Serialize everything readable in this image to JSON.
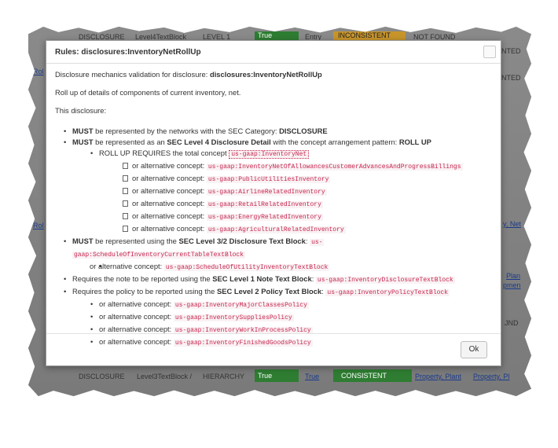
{
  "background_table": {
    "top_row": [
      "DISCLOSURE",
      "Level4TextBlock",
      "LEVEL 1",
      "True",
      "Entry",
      "INCONSISTENT",
      "NOT FOUND"
    ],
    "bottom_row": [
      "DISCLOSURE",
      "Level3TextBlock /",
      "HIERARCHY",
      "True",
      "True",
      "CONSISTENT",
      "Property, Plant",
      "Property, Pl"
    ],
    "side_fragments": [
      "NTED",
      "Rol",
      "NTED",
      "y, Net",
      "Plan",
      "pmen",
      "JND",
      "Rol"
    ]
  },
  "dialog": {
    "title": "Rules: disclosures:InventoryNetRollUp",
    "intro_prefix": "Disclosure mechanics validation for disclosure: ",
    "intro_name": "disclosures:InventoryNetRollUp",
    "description": "Roll up of details of components of current inventory, net.",
    "this_disclosure": "This disclosure:",
    "must": "MUST",
    "rule1_text": " be represented by the networks with the SEC Category: ",
    "rule1_value": "DISCLOSURE",
    "rule2_text": " be represented as an ",
    "rule2_bold": "SEC Level 4 Disclosure Detail",
    "rule2_text2": " with the concept arrangement pattern: ",
    "rule2_value": "ROLL UP",
    "rollup_text": "ROLL UP REQUIRES the total concept ",
    "rollup_concept": "us-gaap:InventoryNet",
    "alt_label": "or alternative concept: ",
    "rollup_alternatives": [
      "us-gaap:InventoryNetOfAllowancesCustomerAdvancesAndProgressBillings",
      "us-gaap:PublicUtilitiesInventory",
      "us-gaap:AirlineRelatedInventory",
      "us-gaap:RetailRelatedInventory",
      "us-gaap:EnergyRelatedInventory",
      "us-gaap:AgriculturalRelatedInventory"
    ],
    "rule3_text": " be represented using the ",
    "rule3_bold": "SEC Level 3/2 Disclosure Text Block",
    "rule3_concept_a": "us-",
    "rule3_concept_b": "gaap:ScheduleOfInventoryCurrentTableTextBlock",
    "rule3_alternative": "us-gaap:ScheduleOfUtilityInventoryTextBlock",
    "rule4_text": "Requires the note to be reported using the ",
    "rule4_bold": "SEC Level 1 Note Text Block",
    "rule4_concept": "us-gaap:InventoryDisclosureTextBlock",
    "rule5_text": "Requires the policy to be reported using the ",
    "rule5_bold": "SEC Level 2 Policy Text Block",
    "rule5_concept": "us-gaap:InventoryPolicyTextBlock",
    "policy_alternatives": [
      "us-gaap:InventoryMajorClassesPolicy",
      "us-gaap:InventorySuppliesPolicy",
      "us-gaap:InventoryWorkInProcessPolicy",
      "us-gaap:InventoryFinishedGoodsPolicy"
    ],
    "ok_label": "Ok"
  },
  "colors": {
    "true_cell": "#2e7d32",
    "inconsistent_cell": "#c8952b",
    "concept_text": "#c7254e"
  }
}
